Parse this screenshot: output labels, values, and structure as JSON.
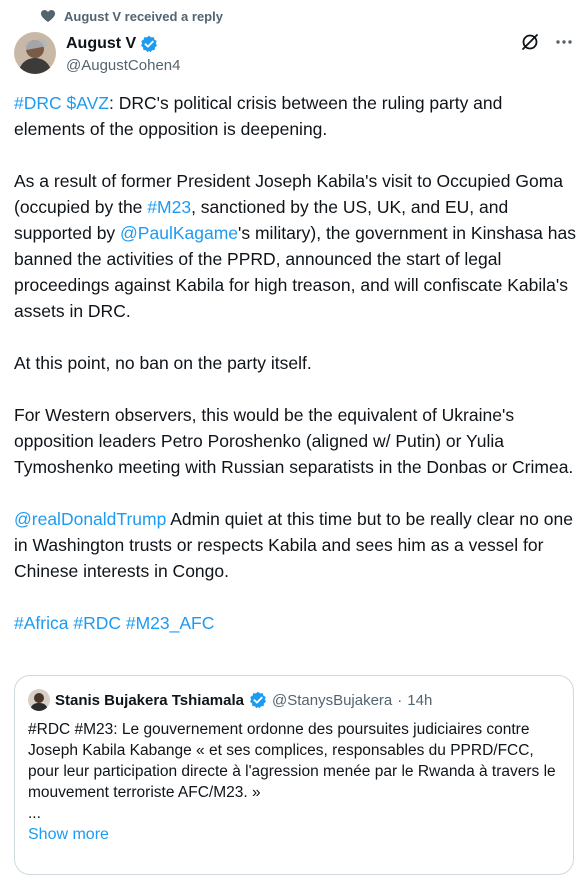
{
  "social_context": {
    "text": "August V received a reply",
    "icon": "heart-check-icon"
  },
  "author": {
    "name": "August V",
    "handle": "@AugustCohen4",
    "verified_color": "#1d9bf0"
  },
  "top_actions": [
    "grok-icon",
    "more-icon"
  ],
  "tweet": {
    "p1_a": "#DRC",
    "p1_b": " ",
    "p1_c": "$AVZ",
    "p1_d": ":  DRC's political crisis between the ruling party and elements of the opposition is deepening.",
    "p2_a": "As a result of former President Joseph Kabila's visit to Occupied Goma (occupied by the ",
    "p2_b": "#M23",
    "p2_c": ", sanctioned by the US, UK, and EU, and supported by ",
    "p2_d": "@PaulKagame",
    "p2_e": "'s military), the government in Kinshasa has banned the activities of the PPRD, announced the start of legal proceedings against Kabila for high treason, and will confiscate Kabila's assets in DRC.",
    "p3": "At this point, no ban on the party itself.",
    "p4": "For Western observers, this would be the equivalent of Ukraine's opposition leaders Petro Poroshenko (aligned w/ Putin) or Yulia Tymoshenko meeting with Russian separatists in the Donbas or Crimea.",
    "p5_a": "@realDonaldTrump",
    "p5_b": " Admin quiet at this time but to be really clear no one in Washington trusts or respects Kabila and sees him as a vessel for Chinese interests in Congo.",
    "p6_a": "#Africa",
    "p6_b": "#RDC",
    "p6_c": "#M23_AFC"
  },
  "quote": {
    "name": "Stanis Bujakera Tshiamala",
    "handle": "@StanysBujakera",
    "separator": "·",
    "time": "14h",
    "text": "#RDC #M23: Le gouvernement ordonne des poursuites judiciaires contre Joseph Kabila Kabange « et ses complices, responsables du PPRD/FCC, pour leur participation directe à l'agression menée par le Rwanda à travers le mouvement terroriste AFC/M23. »",
    "ellipsis": "...",
    "show_more": "Show more"
  },
  "colors": {
    "link": "#1d9bf0",
    "text": "#0f1419",
    "muted": "#536471",
    "border": "#cfd9de"
  }
}
